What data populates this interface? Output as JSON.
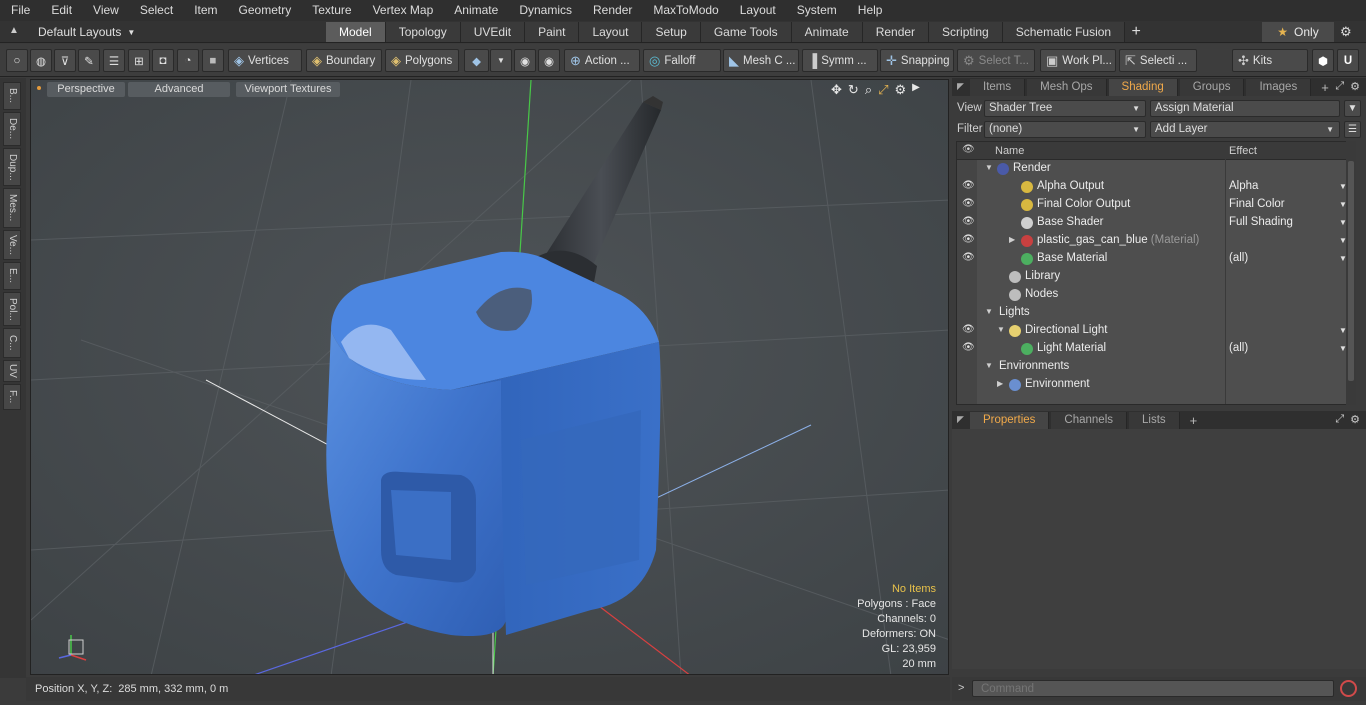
{
  "menu": [
    "File",
    "Edit",
    "View",
    "Select",
    "Item",
    "Geometry",
    "Texture",
    "Vertex Map",
    "Animate",
    "Dynamics",
    "Render",
    "MaxToModo",
    "Layout",
    "System",
    "Help"
  ],
  "layout_selector": "Default Layouts",
  "layout_tabs": [
    {
      "label": "Model",
      "active": true
    },
    {
      "label": "Topology",
      "active": false
    },
    {
      "label": "UVEdit",
      "active": false
    },
    {
      "label": "Paint",
      "active": false
    },
    {
      "label": "Layout",
      "active": false
    },
    {
      "label": "Setup",
      "active": false
    },
    {
      "label": "Game Tools",
      "active": false
    },
    {
      "label": "Animate",
      "active": false
    },
    {
      "label": "Render",
      "active": false
    },
    {
      "label": "Scripting",
      "active": false
    },
    {
      "label": "Schematic Fusion",
      "active": false
    }
  ],
  "only_label": "Only",
  "toolbar": {
    "vertices": "Vertices",
    "boundary": "Boundary",
    "polygons": "Polygons",
    "action": "Action ...",
    "falloff": "Falloff",
    "mesh": "Mesh C ...",
    "symmetry": "Symm ...",
    "snapping": "Snapping",
    "select_t": "Select T...",
    "work_plane": "Work Pl...",
    "selection": "Selecti ...",
    "kits": "Kits"
  },
  "left_tabs": [
    "B...",
    "De...",
    "Dup...",
    "Mes...",
    "Ve...",
    "E...",
    "Pol...",
    "C...",
    "UV",
    "F..."
  ],
  "viewport": {
    "perspective": "Perspective",
    "advanced": "Advanced",
    "textures": "Viewport Textures",
    "stats": {
      "items": "No Items",
      "polygons": "Polygons : Face",
      "channels": "Channels: 0",
      "deformers": "Deformers: ON",
      "gl": "GL: 23,959",
      "units": "20 mm"
    }
  },
  "status": {
    "label": "Position X, Y, Z:",
    "value": "285 mm, 332 mm, 0 m"
  },
  "panel_tabs": [
    {
      "label": "Items",
      "active": false
    },
    {
      "label": "Mesh Ops",
      "active": false
    },
    {
      "label": "Shading",
      "active": true
    },
    {
      "label": "Groups",
      "active": false
    },
    {
      "label": "Images",
      "active": false
    }
  ],
  "shader": {
    "view_label": "View",
    "view_value": "Shader Tree",
    "assign": "Assign Material",
    "filter_label": "Filter",
    "filter_value": "(none)",
    "add_layer": "Add Layer",
    "col_name": "Name",
    "col_effect": "Effect",
    "rows": [
      {
        "name": "Render",
        "sub": "",
        "effect": "",
        "indent": 0,
        "eye": false,
        "tri": "▼",
        "icon": "#4a5aa8"
      },
      {
        "name": "Alpha Output",
        "sub": "",
        "effect": "Alpha",
        "indent": 2,
        "eye": true,
        "tri": "",
        "icon": "#d8b840"
      },
      {
        "name": "Final Color Output",
        "sub": "",
        "effect": "Final Color",
        "indent": 2,
        "eye": true,
        "tri": "",
        "icon": "#d8b840"
      },
      {
        "name": "Base Shader",
        "sub": "",
        "effect": "Full Shading",
        "indent": 2,
        "eye": true,
        "tri": "",
        "icon": "#d0d0d0"
      },
      {
        "name": "plastic_gas_can_blue",
        "sub": " (Material)",
        "effect": "",
        "indent": 2,
        "eye": true,
        "tri": "▶",
        "icon": "#c84040"
      },
      {
        "name": "Base Material",
        "sub": "",
        "effect": "(all)",
        "indent": 2,
        "eye": true,
        "tri": "",
        "icon": "#4caf60"
      },
      {
        "name": "Library",
        "sub": "",
        "effect": "",
        "indent": 1,
        "eye": false,
        "tri": "",
        "icon": "#bdbdbd"
      },
      {
        "name": "Nodes",
        "sub": "",
        "effect": "",
        "indent": 1,
        "eye": false,
        "tri": "",
        "icon": "#bdbdbd"
      },
      {
        "name": "Lights",
        "sub": "",
        "effect": "",
        "indent": 0,
        "eye": false,
        "tri": "▼",
        "icon": ""
      },
      {
        "name": "Directional Light",
        "sub": "",
        "effect": "",
        "indent": 1,
        "eye": true,
        "tri": "▼",
        "icon": "#e6d070"
      },
      {
        "name": "Light Material",
        "sub": "",
        "effect": "(all)",
        "indent": 2,
        "eye": true,
        "tri": "",
        "icon": "#4caf60"
      },
      {
        "name": "Environments",
        "sub": "",
        "effect": "",
        "indent": 0,
        "eye": false,
        "tri": "▼",
        "icon": ""
      },
      {
        "name": "Environment",
        "sub": "",
        "effect": "",
        "indent": 1,
        "eye": false,
        "tri": "▶",
        "icon": "#6a8fd0"
      }
    ]
  },
  "props_tabs": [
    {
      "label": "Properties",
      "active": true
    },
    {
      "label": "Channels",
      "active": false
    },
    {
      "label": "Lists",
      "active": false
    }
  ],
  "command_placeholder": "Command"
}
